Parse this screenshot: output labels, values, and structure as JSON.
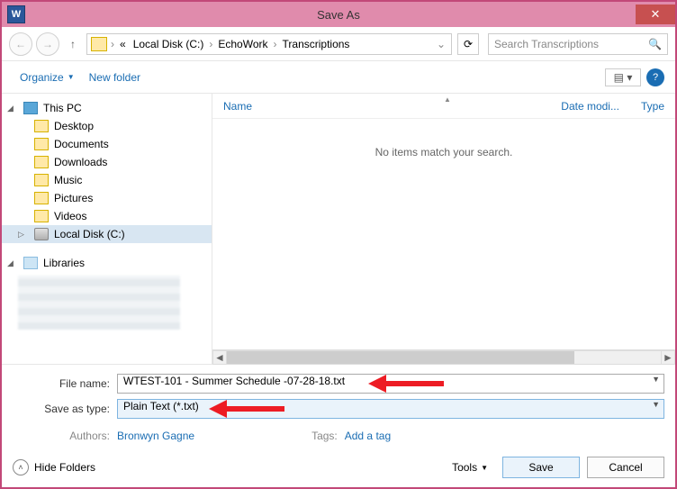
{
  "title": "Save As",
  "nav": {
    "path_prefix": "«",
    "segments": [
      "Local Disk (C:)",
      "EchoWork",
      "Transcriptions"
    ]
  },
  "search": {
    "placeholder": "Search Transcriptions"
  },
  "toolbar": {
    "organize": "Organize",
    "new_folder": "New folder"
  },
  "tree": {
    "this_pc": "This PC",
    "items": [
      "Desktop",
      "Documents",
      "Downloads",
      "Music",
      "Pictures",
      "Videos",
      "Local Disk (C:)"
    ],
    "libraries": "Libraries"
  },
  "columns": {
    "name": "Name",
    "date": "Date modi...",
    "type": "Type"
  },
  "empty": "No items match your search.",
  "fields": {
    "filename_label": "File name:",
    "filename_value": "WTEST-101 - Summer Schedule -07-28-18.txt",
    "saveastype_label": "Save as type:",
    "saveastype_value": "Plain Text (*.txt)",
    "authors_label": "Authors:",
    "authors_value": "Bronwyn Gagne",
    "tags_label": "Tags:",
    "tags_value": "Add a tag"
  },
  "footer": {
    "hide_folders": "Hide Folders",
    "tools": "Tools",
    "save": "Save",
    "cancel": "Cancel"
  }
}
